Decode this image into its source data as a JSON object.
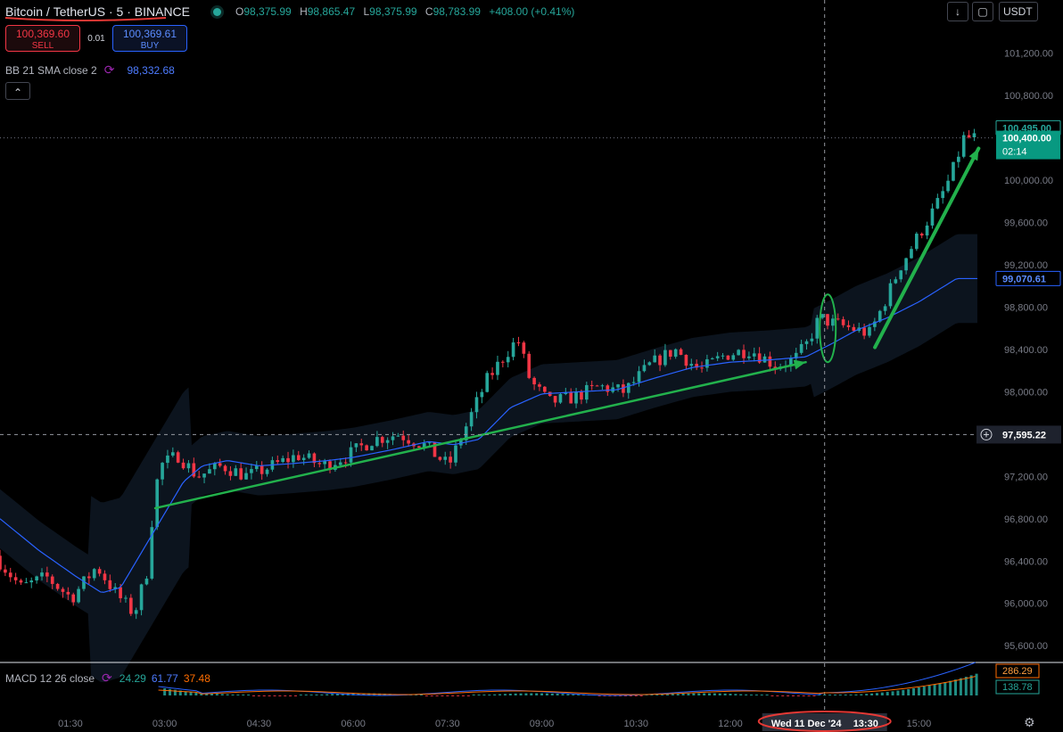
{
  "header": {
    "symbol_base": "Bitcoin",
    "symbol_sep": " / ",
    "symbol_quote": "TetherUS",
    "interval_sep": " · ",
    "interval": "5",
    "exchange_sep": " · ",
    "exchange": "BINANCE",
    "open_label": "O",
    "open": "98,375.99",
    "high_label": "H",
    "high": "98,865.47",
    "low_label": "L",
    "low": "98,375.99",
    "close_label": "C",
    "close": "98,783.99",
    "change": "+408.00 (+0.41%)"
  },
  "trade": {
    "sell_price": "100,369.60",
    "sell_label": "SELL",
    "spread": "0.01",
    "buy_price": "100,369.61",
    "buy_label": "BUY"
  },
  "bb_indicator": {
    "name": "BB 21 SMA close 2",
    "value": "98,332.68"
  },
  "macd_indicator": {
    "name": "MACD 12 26 close",
    "hist": "24.29",
    "macd": "61.77",
    "signal": "37.48"
  },
  "toolbar": {
    "currency": "USDT",
    "down_icon": "down-arrow-icon",
    "square_icon": "fullscreen-icon"
  },
  "colors": {
    "up": "#26a69a",
    "down": "#f23645",
    "bb_mid": "#2962ff",
    "annotation": "#22b14c",
    "highlight": "#e53935"
  },
  "chart_data": {
    "type": "candlestick",
    "title": "",
    "xlabel": "",
    "ylabel": "",
    "ylim": [
      95450,
      101450
    ],
    "y_ticks": [
      "101,200.00",
      "100,800.00",
      "100,400.00",
      "100,000.00",
      "99,600.00",
      "99,200.00",
      "98,800.00",
      "98,400.00",
      "98,000.00",
      "97,200.00",
      "96,800.00",
      "96,400.00",
      "96,000.00",
      "95,600.00"
    ],
    "y_tick_values": [
      101200,
      100800,
      100400,
      100000,
      99600,
      99200,
      98800,
      98400,
      98000,
      97200,
      96800,
      96400,
      96000,
      95600
    ],
    "x_ticks": [
      "01:30",
      "03:00",
      "04:30",
      "06:00",
      "07:30",
      "09:00",
      "10:30",
      "12:00",
      "15:00"
    ],
    "x_tick_hours": [
      1.5,
      3,
      4.5,
      6,
      7.5,
      9,
      10.5,
      12,
      15
    ],
    "x_range_hours": [
      0.38,
      16.2
    ],
    "price_labels": {
      "last_high": "100,495.00",
      "current": "100,400.00",
      "countdown": "02:14",
      "bb_mid": "99,070.61",
      "crosshair": "97,595.22"
    },
    "crosshair": {
      "time": "Wed 11 Dec '24",
      "time_hm": "13:30",
      "hour": 13.5,
      "price": 97595.22
    },
    "trend_lines": [
      {
        "from": [
          2.85,
          96900
        ],
        "to": [
          13.2,
          98280
        ]
      },
      {
        "from": [
          14.3,
          98420
        ],
        "to": [
          15.95,
          100300
        ]
      }
    ],
    "price_trace_key_points": {
      "time_hours": [
        0.38,
        0.8,
        1.2,
        1.6,
        2.0,
        2.3,
        2.6,
        2.8,
        2.9,
        3.0,
        3.3,
        3.6,
        4.0,
        4.4,
        4.8,
        5.2,
        5.6,
        6.0,
        6.4,
        6.8,
        7.2,
        7.6,
        7.9,
        8.2,
        8.5,
        8.7,
        8.9,
        9.2,
        9.6,
        10.0,
        10.4,
        10.8,
        11.2,
        11.6,
        12.0,
        12.4,
        12.8,
        13.1,
        13.3,
        13.5,
        13.7,
        14.0,
        14.3,
        14.5,
        14.8,
        15.1,
        15.4,
        15.6,
        15.8
      ],
      "close": [
        96450,
        96150,
        96250,
        96050,
        96350,
        96100,
        95900,
        96300,
        96900,
        97300,
        97400,
        97200,
        97300,
        97200,
        97300,
        97400,
        97300,
        97400,
        97550,
        97600,
        97500,
        97300,
        97700,
        98100,
        98350,
        98500,
        98100,
        97900,
        97950,
        98050,
        98000,
        98250,
        98400,
        98200,
        98350,
        98400,
        98250,
        98300,
        98450,
        98700,
        98650,
        98600,
        98550,
        98800,
        99200,
        99500,
        99800,
        100050,
        100400
      ]
    },
    "bb_mid_key_points": {
      "time_hours": [
        0.38,
        1.0,
        1.6,
        2.0,
        2.3,
        2.6,
        3.0,
        3.3,
        3.6,
        4.0,
        4.5,
        5.0,
        5.6,
        6.0,
        6.6,
        7.2,
        7.6,
        8.0,
        8.5,
        9.0,
        9.6,
        10.2,
        10.8,
        11.4,
        12.0,
        12.6,
        13.2,
        13.6,
        14.0,
        14.5,
        15.0,
        15.6
      ],
      "values": [
        96800,
        96500,
        96250,
        96100,
        96150,
        96450,
        96850,
        97150,
        97300,
        97350,
        97300,
        97320,
        97350,
        97380,
        97450,
        97530,
        97500,
        97550,
        97850,
        97980,
        98000,
        98020,
        98130,
        98230,
        98280,
        98300,
        98330,
        98450,
        98580,
        98700,
        98850,
        99070
      ]
    },
    "macd": {
      "hist": 24.29,
      "macd": 61.77,
      "signal": 37.48,
      "axis_labels": [
        "286.29",
        "138.78"
      ]
    }
  }
}
